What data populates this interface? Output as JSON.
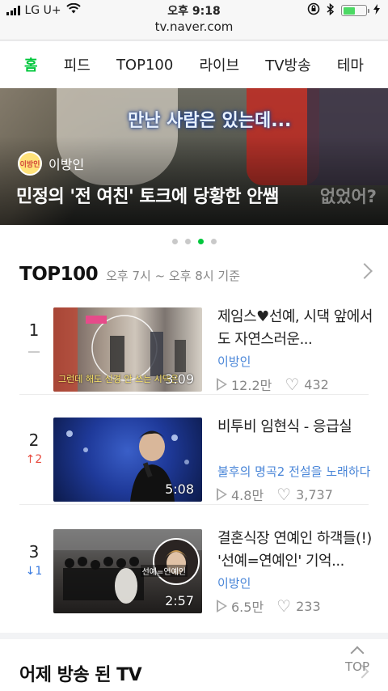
{
  "status_bar": {
    "carrier": "LG U+",
    "time": "오후 9:18"
  },
  "browser": {
    "url": "tv.naver.com"
  },
  "nav": {
    "tabs": [
      {
        "label": "홈",
        "active": true
      },
      {
        "label": "피드",
        "active": false
      },
      {
        "label": "TOP100",
        "active": false
      },
      {
        "label": "라이브",
        "active": false
      },
      {
        "label": "TV방송",
        "active": false
      },
      {
        "label": "테마",
        "active": false
      }
    ]
  },
  "hero": {
    "overlay_caption": "만난 사람은 있는데...",
    "channel_name": "이방인",
    "channel_logo_text": "이방인",
    "headline": "민정의 '전 여친' 토크에 당황한 안쌤",
    "background_text": "없었어?",
    "slide_count": 4,
    "active_slide": 3
  },
  "colors": {
    "accent": "#00c73c",
    "rank_up": "#e84a3e",
    "rank_down": "#3a7be0",
    "channel_link": "#4a86d8"
  },
  "top100": {
    "title": "TOP100",
    "subtitle": "오후 7시 ~ 오후 8시 기준",
    "items": [
      {
        "rank": "1",
        "change": "",
        "change_dir": "same",
        "duration": "3:09",
        "title": "제임스♥선예, 시댁 앞에서도 자연스러운...",
        "source": "이방인",
        "views": "12.2만",
        "likes": "432",
        "thumb_caption": "그런데 해도 신경 안 쓰는 시댁은"
      },
      {
        "rank": "2",
        "change": "↑2",
        "change_dir": "up",
        "duration": "5:08",
        "title": "비투비 임현식 - 응급실",
        "source": "불후의 명곡2 전설을 노래하다",
        "views": "4.8만",
        "likes": "3,737",
        "thumb_caption": ""
      },
      {
        "rank": "3",
        "change": "↓1",
        "change_dir": "down",
        "duration": "2:57",
        "title": "결혼식장 연예인 하객들(!) '선예=연예인' 기억...",
        "source": "이방인",
        "views": "6.5만",
        "likes": "233",
        "thumb_caption": "선예=연예인"
      }
    ]
  },
  "bottom": {
    "section_title": "어제 방송 된 TV",
    "top_button": "TOP"
  }
}
